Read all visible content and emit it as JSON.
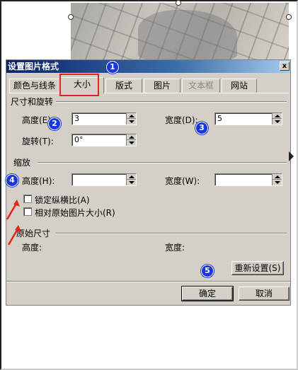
{
  "dialog": {
    "title": "设置图片格式",
    "close_label": "x"
  },
  "tabs": [
    {
      "label": "颜色与线条"
    },
    {
      "label": "大小"
    },
    {
      "label": "版式"
    },
    {
      "label": "图片"
    },
    {
      "label": "文本框"
    },
    {
      "label": "网站"
    }
  ],
  "size_rotate": {
    "section": "尺寸和旋转",
    "height_label": "高度(E):",
    "height_value": "3",
    "width_label": "宽度(D):",
    "width_value": "5",
    "rotate_label": "旋转(T):",
    "rotate_value": "0°"
  },
  "scale": {
    "section": "缩放",
    "height_label": "高度(H):",
    "height_value": "",
    "width_label": "宽度(W):",
    "width_value": ""
  },
  "checkboxes": {
    "lock_aspect": "锁定纵横比(A)",
    "relative_original": "相对原始图片大小(R)"
  },
  "original": {
    "section": "原始尺寸",
    "height_label": "高度:",
    "width_label": "宽度:"
  },
  "buttons": {
    "reset": "重新设置(S)",
    "ok": "确定",
    "cancel": "取消"
  },
  "markers": [
    "1",
    "2",
    "3",
    "4",
    "5"
  ],
  "colors": {
    "marker": "#1a35d8",
    "highlight": "#e8231e",
    "titlebar": "#0a246a"
  }
}
